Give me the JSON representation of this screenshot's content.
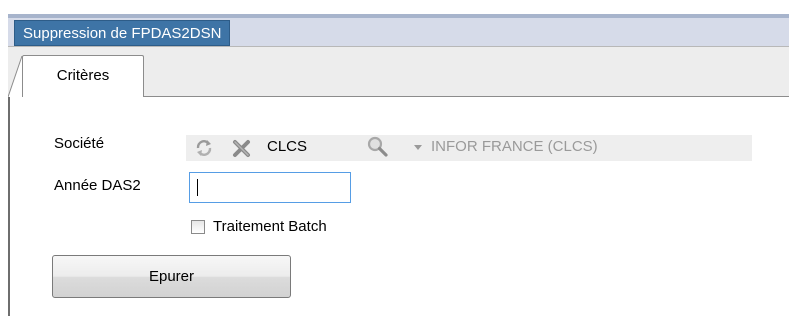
{
  "document_tab": {
    "label": "Suppression de FPDAS2DSN"
  },
  "tabs": [
    {
      "label": "Critères",
      "active": true
    }
  ],
  "form": {
    "societe": {
      "label": "Société",
      "code": "CLCS",
      "name": "INFOR FRANCE (CLCS)",
      "icons": [
        "refresh-icon",
        "clear-icon",
        "search-icon",
        "dropdown-arrow-icon"
      ]
    },
    "annee": {
      "label": "Année DAS2",
      "value": "",
      "placeholder": ""
    },
    "batch": {
      "label": "Traitement Batch",
      "checked": false
    },
    "submit": {
      "label": "Epurer"
    }
  },
  "colors": {
    "tab_accent": "#3e74a6",
    "input_focus_border": "#569de5",
    "panel_bg": "#d6dbe9"
  }
}
